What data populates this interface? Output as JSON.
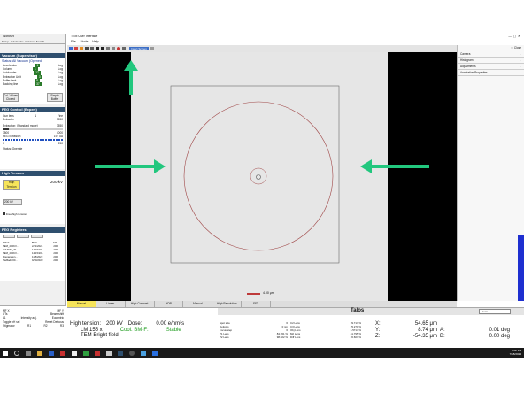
{
  "left_window": {
    "title": "Workset",
    "tabs": [
      "Setup",
      "Autoloader",
      "Column",
      "Search"
    ]
  },
  "vacuum": {
    "header": "Vacuum (Supervisor)",
    "status": "Status: All Vacuum (Opened)",
    "rows": [
      [
        "Accelerator",
        "1",
        "Log"
      ],
      [
        "Column",
        "1",
        "Log"
      ],
      [
        "Autoloader",
        "17",
        "Log"
      ],
      [
        "Extraction Unit",
        "3",
        "Log"
      ],
      [
        "Buffer tank",
        "8",
        "Log"
      ],
      [
        "Backing line",
        "37",
        "Log"
      ]
    ],
    "btn_col": "Col. Valves Closed",
    "btn_buffer": "Empty Buffer"
  },
  "feg": {
    "header": "FEG Control (Expert)",
    "gun_lens": "Gun lens",
    "gun_lens_val": "1",
    "fine": "Fine",
    "extractor": "Extractor",
    "extractor_val": "3550",
    "extraction_label": "Extraction: (Standard mode)",
    "extraction_val": "3550",
    "v_min": "3500",
    "v_max": "4000",
    "emission_label": "FEG Emission",
    "emission_val": "197",
    "emission_unit": "uA",
    "e_min": "0",
    "e_max": "250",
    "status": "Status: Operate"
  },
  "ht": {
    "header": "High Tension",
    "btn": "High Tension",
    "value": "200 kV",
    "select": "200 kV",
    "free": "Free high tension"
  },
  "registers": {
    "header": "FEG Registers",
    "cols": [
      "Label",
      "Date",
      "kV"
    ],
    "rows": [
      [
        "TEM_200KV...",
        "2/11/2024",
        "200"
      ],
      [
        "LM TEM_20...",
        "12/15/20...",
        "200"
      ],
      [
        "TEM_200KV...",
        "12/15/20...",
        "200"
      ],
      [
        "Preparation...",
        "11/5/2023",
        "200"
      ],
      [
        "SteBadi200...",
        "9/30/2023",
        "200"
      ]
    ]
  },
  "bottom_left": {
    "lines": [
      "MF X",
      "MF Y",
      "UTs",
      "Beam shift",
      "L1",
      "Intensity adj.",
      "Toggle pH sel",
      "Stigmator",
      "R1",
      "R2",
      "R3",
      "Eucentric",
      "Reset Defocus"
    ]
  },
  "main_window": {
    "title": "TEM User Interface",
    "menu": [
      "File",
      "Mode",
      "Help"
    ],
    "toolbar_label": "Insert Screen",
    "close": "Close"
  },
  "right_panel": {
    "items": [
      "Camera",
      "Histogram",
      "Adjustments",
      "Annotation Properties"
    ]
  },
  "image": {
    "scale_text": "4.00 μm"
  },
  "modes": [
    "Manual",
    "Linear",
    "High Contrast",
    "HDR",
    "Manual",
    "High Resolution",
    "FFT"
  ],
  "talos": {
    "title": "Talos",
    "select": "None"
  },
  "status": {
    "ht_label": "High tension:",
    "ht_val": "200 kV",
    "dose_label": "Dose:",
    "dose_val": "0.00 e/nm²s",
    "mag": "LM 155 x",
    "cool": "Cool. BM-F:",
    "stable": "Stable",
    "mode": "TEM Bright field",
    "lens_rows": [
      [
        "Spot size",
        "6",
        "C2 Lens",
        "39.717 %"
      ],
      [
        "Defocus",
        "0 nm",
        "C3 Lens",
        "25.270 %"
      ],
      [
        "Focus step",
        "6",
        "Obj Lens",
        "6.5714 %"
      ],
      [
        "P1 Lens",
        "84.551 %",
        "M2 Lens",
        "81.795 %"
      ],
      [
        "P2 Lens",
        "98.022 %",
        "Diff Lens",
        "26.607 %"
      ]
    ],
    "stage": [
      [
        "X:",
        "54.65 μm",
        ""
      ],
      [
        "Y:",
        "8.74 μm",
        "A:",
        "0.01 deg"
      ],
      [
        "Z:",
        "-54.35 μm",
        "B:",
        "0.00 deg"
      ]
    ]
  },
  "taskbar": {
    "time": "8:05 AM",
    "date": "7/18/2024"
  },
  "colors": {
    "arrow": "#22c77e",
    "panel_head": "#2f4f6e",
    "status_green": "#1a9a1a"
  }
}
